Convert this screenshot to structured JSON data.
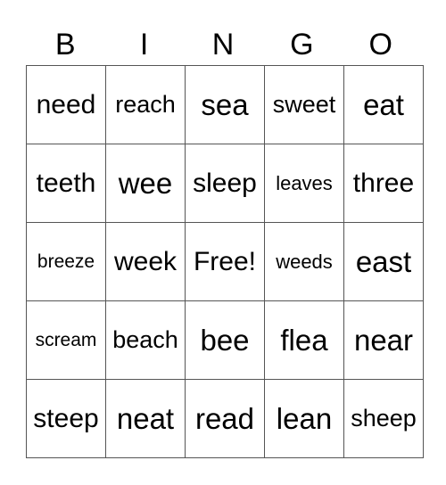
{
  "title_letters": [
    "B",
    "I",
    "N",
    "G",
    "O"
  ],
  "rows": [
    [
      {
        "word": "need",
        "size": "l"
      },
      {
        "word": "reach",
        "size": "m"
      },
      {
        "word": "sea",
        "size": "xl"
      },
      {
        "word": "sweet",
        "size": "m"
      },
      {
        "word": "eat",
        "size": "xl"
      }
    ],
    [
      {
        "word": "teeth",
        "size": "l"
      },
      {
        "word": "wee",
        "size": "xl"
      },
      {
        "word": "sleep",
        "size": "l"
      },
      {
        "word": "leaves",
        "size": "s"
      },
      {
        "word": "three",
        "size": "l"
      }
    ],
    [
      {
        "word": "breeze",
        "size": "xs"
      },
      {
        "word": "week",
        "size": "l"
      },
      {
        "word": "Free!",
        "size": "l"
      },
      {
        "word": "weeds",
        "size": "s"
      },
      {
        "word": "east",
        "size": "xl"
      }
    ],
    [
      {
        "word": "scream",
        "size": "xs"
      },
      {
        "word": "beach",
        "size": "m"
      },
      {
        "word": "bee",
        "size": "xl"
      },
      {
        "word": "flea",
        "size": "xl"
      },
      {
        "word": "near",
        "size": "xl"
      }
    ],
    [
      {
        "word": "steep",
        "size": "l"
      },
      {
        "word": "neat",
        "size": "xl"
      },
      {
        "word": "read",
        "size": "xl"
      },
      {
        "word": "lean",
        "size": "xl"
      },
      {
        "word": "sheep",
        "size": "m"
      }
    ]
  ]
}
